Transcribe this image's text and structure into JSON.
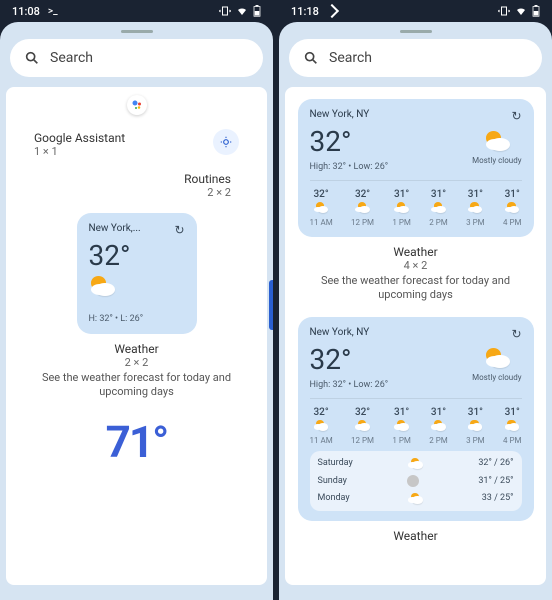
{
  "left": {
    "time": "11:08",
    "search": "Search",
    "assistant": {
      "title": "Google Assistant",
      "size": "1 × 1"
    },
    "routines": {
      "title": "Routines",
      "size": "2 × 2"
    },
    "weather_widget": {
      "city": "New York,...",
      "temp": "32°",
      "hl": "H: 32° • L: 26°",
      "title": "Weather",
      "size": "2 × 2",
      "desc": "See the weather forecast for today and upcoming days"
    },
    "bottom_num": "71°"
  },
  "right": {
    "time": "11:18",
    "search": "Search",
    "widget4x2": {
      "city": "New York, NY",
      "temp": "32°",
      "hl": "High: 32° • Low: 26°",
      "cond": "Mostly cloudy",
      "hours": [
        {
          "t": "32°",
          "h": "11 AM"
        },
        {
          "t": "32°",
          "h": "12 PM"
        },
        {
          "t": "31°",
          "h": "1 PM"
        },
        {
          "t": "31°",
          "h": "2 PM"
        },
        {
          "t": "31°",
          "h": "3 PM"
        },
        {
          "t": "31°",
          "h": "4 PM"
        }
      ],
      "title": "Weather",
      "size": "4 × 2",
      "desc": "See the weather forecast for today and upcoming days"
    },
    "widget4x3": {
      "city": "New York, NY",
      "temp": "32°",
      "hl": "High: 32° • Low: 26°",
      "cond": "Mostly cloudy",
      "hours": [
        {
          "t": "32°",
          "h": "11 AM"
        },
        {
          "t": "32°",
          "h": "12 PM"
        },
        {
          "t": "31°",
          "h": "1 PM"
        },
        {
          "t": "31°",
          "h": "2 PM"
        },
        {
          "t": "31°",
          "h": "3 PM"
        },
        {
          "t": "31°",
          "h": "4 PM"
        }
      ],
      "days": [
        {
          "d": "Saturday",
          "r": "32° / 26°"
        },
        {
          "d": "Sunday",
          "r": "31° / 25°"
        },
        {
          "d": "Monday",
          "r": "33 / 25°"
        }
      ]
    },
    "footer": "Weather"
  }
}
